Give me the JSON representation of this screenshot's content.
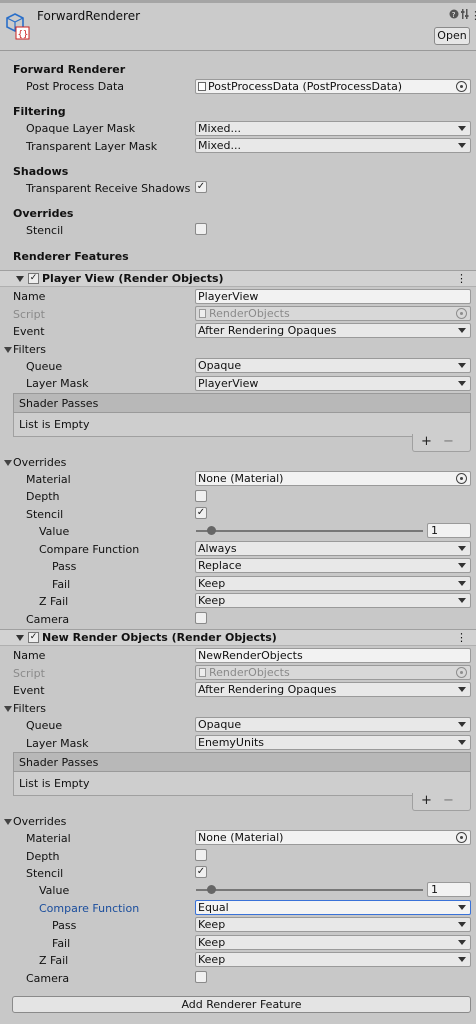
{
  "header": {
    "title": "ForwardRenderer",
    "open_label": "Open",
    "help_icon": "help-icon",
    "settings_icon": "sliders-icon",
    "menu_icon": "kebab-icon"
  },
  "forward_renderer": {
    "section": "Forward Renderer",
    "post_process_label": "Post Process Data",
    "post_process_value": "PostProcessData (PostProcessData)"
  },
  "filtering": {
    "section": "Filtering",
    "opaque_label": "Opaque Layer Mask",
    "opaque_value": "Mixed...",
    "transparent_label": "Transparent Layer Mask",
    "transparent_value": "Mixed..."
  },
  "shadows": {
    "section": "Shadows",
    "receive_label": "Transparent Receive Shadows",
    "receive_checked": "✓"
  },
  "overrides": {
    "section": "Overrides",
    "stencil_label": "Stencil",
    "stencil_checked": ""
  },
  "renderer_features_label": "Renderer Features",
  "features": [
    {
      "title": "Player View (Render Objects)",
      "enabled_mark": "✓",
      "name_label": "Name",
      "name_value": "PlayerView",
      "script_label": "Script",
      "script_value": "RenderObjects",
      "event_label": "Event",
      "event_value": "After Rendering Opaques",
      "filters_label": "Filters",
      "queue_label": "Queue",
      "queue_value": "Opaque",
      "layer_mask_label": "Layer Mask",
      "layer_mask_value": "PlayerView",
      "shader_passes_label": "Shader Passes",
      "list_empty": "List is Empty",
      "plus": "+",
      "minus": "−",
      "overrides_label": "Overrides",
      "material_label": "Material",
      "material_value": "None (Material)",
      "depth_label": "Depth",
      "depth_checked": "",
      "stencil_label": "Stencil",
      "stencil_checked": "✓",
      "value_label": "Value",
      "value_value": "1",
      "value_slider_fraction": 0.07,
      "compare_label": "Compare Function",
      "compare_value": "Always",
      "pass_label": "Pass",
      "pass_value": "Replace",
      "fail_label": "Fail",
      "fail_value": "Keep",
      "zfail_label": "Z Fail",
      "zfail_value": "Keep",
      "camera_label": "Camera",
      "camera_checked": ""
    },
    {
      "title": "New Render Objects (Render Objects)",
      "enabled_mark": "✓",
      "name_label": "Name",
      "name_value": "NewRenderObjects",
      "script_label": "Script",
      "script_value": "RenderObjects",
      "event_label": "Event",
      "event_value": "After Rendering Opaques",
      "filters_label": "Filters",
      "queue_label": "Queue",
      "queue_value": "Opaque",
      "layer_mask_label": "Layer Mask",
      "layer_mask_value": "EnemyUnits",
      "shader_passes_label": "Shader Passes",
      "list_empty": "List is Empty",
      "plus": "+",
      "minus": "−",
      "overrides_label": "Overrides",
      "material_label": "Material",
      "material_value": "None (Material)",
      "depth_label": "Depth",
      "depth_checked": "",
      "stencil_label": "Stencil",
      "stencil_checked": "✓",
      "value_label": "Value",
      "value_value": "1",
      "value_slider_fraction": 0.07,
      "compare_label": "Compare Function",
      "compare_value": "Equal",
      "pass_label": "Pass",
      "pass_value": "Keep",
      "fail_label": "Fail",
      "fail_value": "Keep",
      "zfail_label": "Z Fail",
      "zfail_value": "Keep",
      "camera_label": "Camera",
      "camera_checked": ""
    }
  ],
  "add_feature_label": "Add Renderer Feature",
  "colors": {
    "accent": "#3a72d8",
    "panel": "#c8c8c8",
    "label_blue": "#1a4d9c"
  }
}
